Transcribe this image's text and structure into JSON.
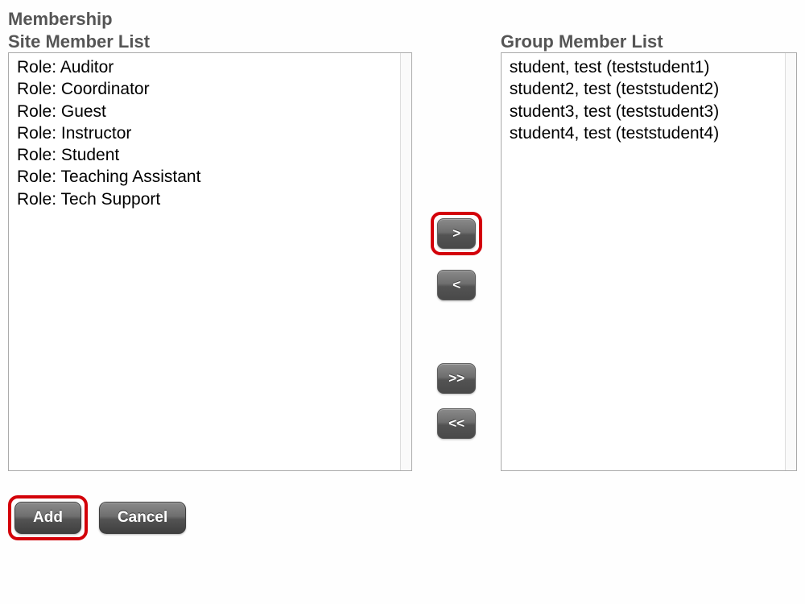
{
  "headings": {
    "membership": "Membership",
    "siteList": "Site Member List",
    "groupList": "Group Member List"
  },
  "siteMembers": {
    "items": [
      "Role: Auditor",
      "Role: Coordinator",
      "Role: Guest",
      "Role: Instructor",
      "Role: Student",
      "Role: Teaching Assistant",
      "Role: Tech Support"
    ]
  },
  "groupMembers": {
    "items": [
      "student, test (teststudent1)",
      "student2, test (teststudent2)",
      "student3, test (teststudent3)",
      "student4, test (teststudent4)"
    ]
  },
  "transfer": {
    "moveRight": ">",
    "moveLeft": "<",
    "moveAllRight": ">>",
    "moveAllLeft": "<<"
  },
  "footer": {
    "add": "Add",
    "cancel": "Cancel"
  }
}
